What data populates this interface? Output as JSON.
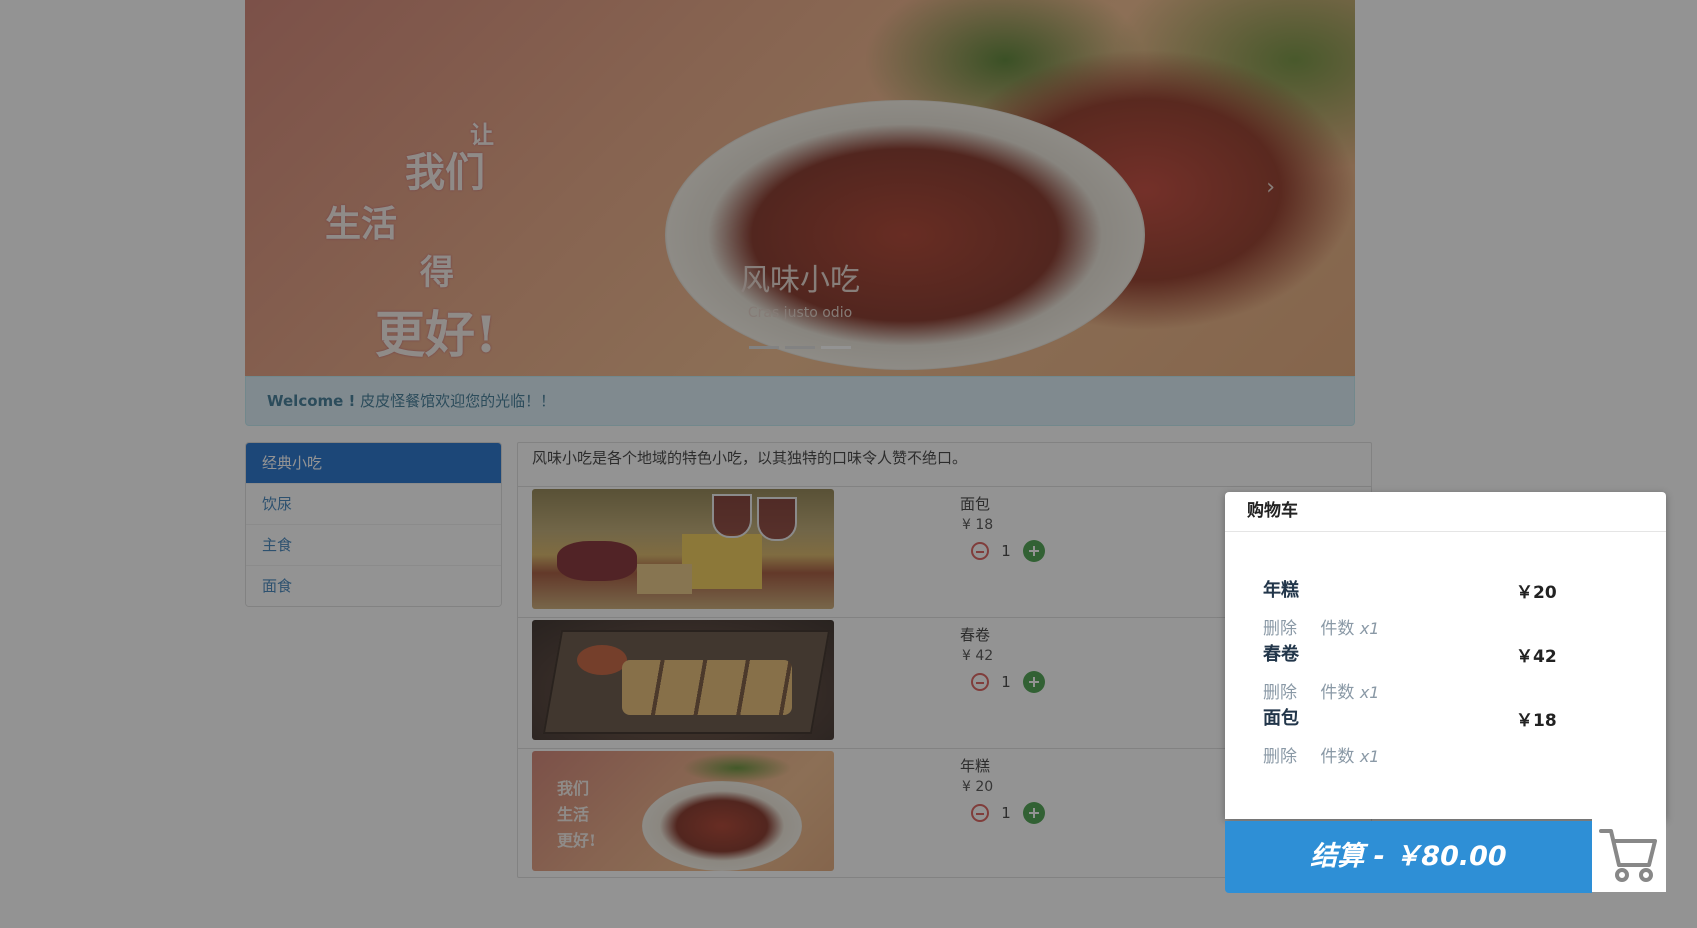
{
  "carousel": {
    "calligraphy": [
      "让",
      "我们",
      "生活",
      "得",
      "更好!"
    ],
    "caption_title": "风味小吃",
    "caption_text": "Cras justo odio",
    "indicators": 3,
    "active_indicator": 3
  },
  "welcome": {
    "strong": "Welcome !",
    "text": "皮皮怪餐馆欢迎您的光临！！"
  },
  "sidebar": {
    "items": [
      {
        "label": "经典小吃",
        "active": true
      },
      {
        "label": "饮尿",
        "active": false
      },
      {
        "label": "主食",
        "active": false
      },
      {
        "label": "面食",
        "active": false
      }
    ]
  },
  "panel": {
    "description": "风味小吃是各个地域的特色小吃，以其独特的口味令人赞不绝口。",
    "products": [
      {
        "name": "面包",
        "price": "¥ 18",
        "qty": "1",
        "image": "wine-cheese-photo"
      },
      {
        "name": "春卷",
        "price": "¥ 42",
        "qty": "1",
        "image": "spring-rolls-photo"
      },
      {
        "name": "年糕",
        "price": "¥ 20",
        "qty": "1",
        "image": "rice-cake-photo"
      }
    ]
  },
  "cart": {
    "title": "购物车",
    "items": [
      {
        "name": "年糕",
        "price": "￥20",
        "delete": "删除",
        "count_label": "件数",
        "count": "x1"
      },
      {
        "name": "春卷",
        "price": "￥42",
        "delete": "删除",
        "count_label": "件数",
        "count": "x1"
      },
      {
        "name": "面包",
        "price": "￥18",
        "delete": "删除",
        "count_label": "件数",
        "count": "x1"
      }
    ],
    "checkout": "结算 - ￥80.00",
    "icon": "shopping-cart-icon"
  },
  "colors": {
    "sidebar_active": "#1166c9",
    "link": "#337ab7",
    "checkout": "#2e8fd6",
    "minus": "#d9534f",
    "plus": "#3c9a40",
    "welcome_bg": "#d9edf7"
  }
}
